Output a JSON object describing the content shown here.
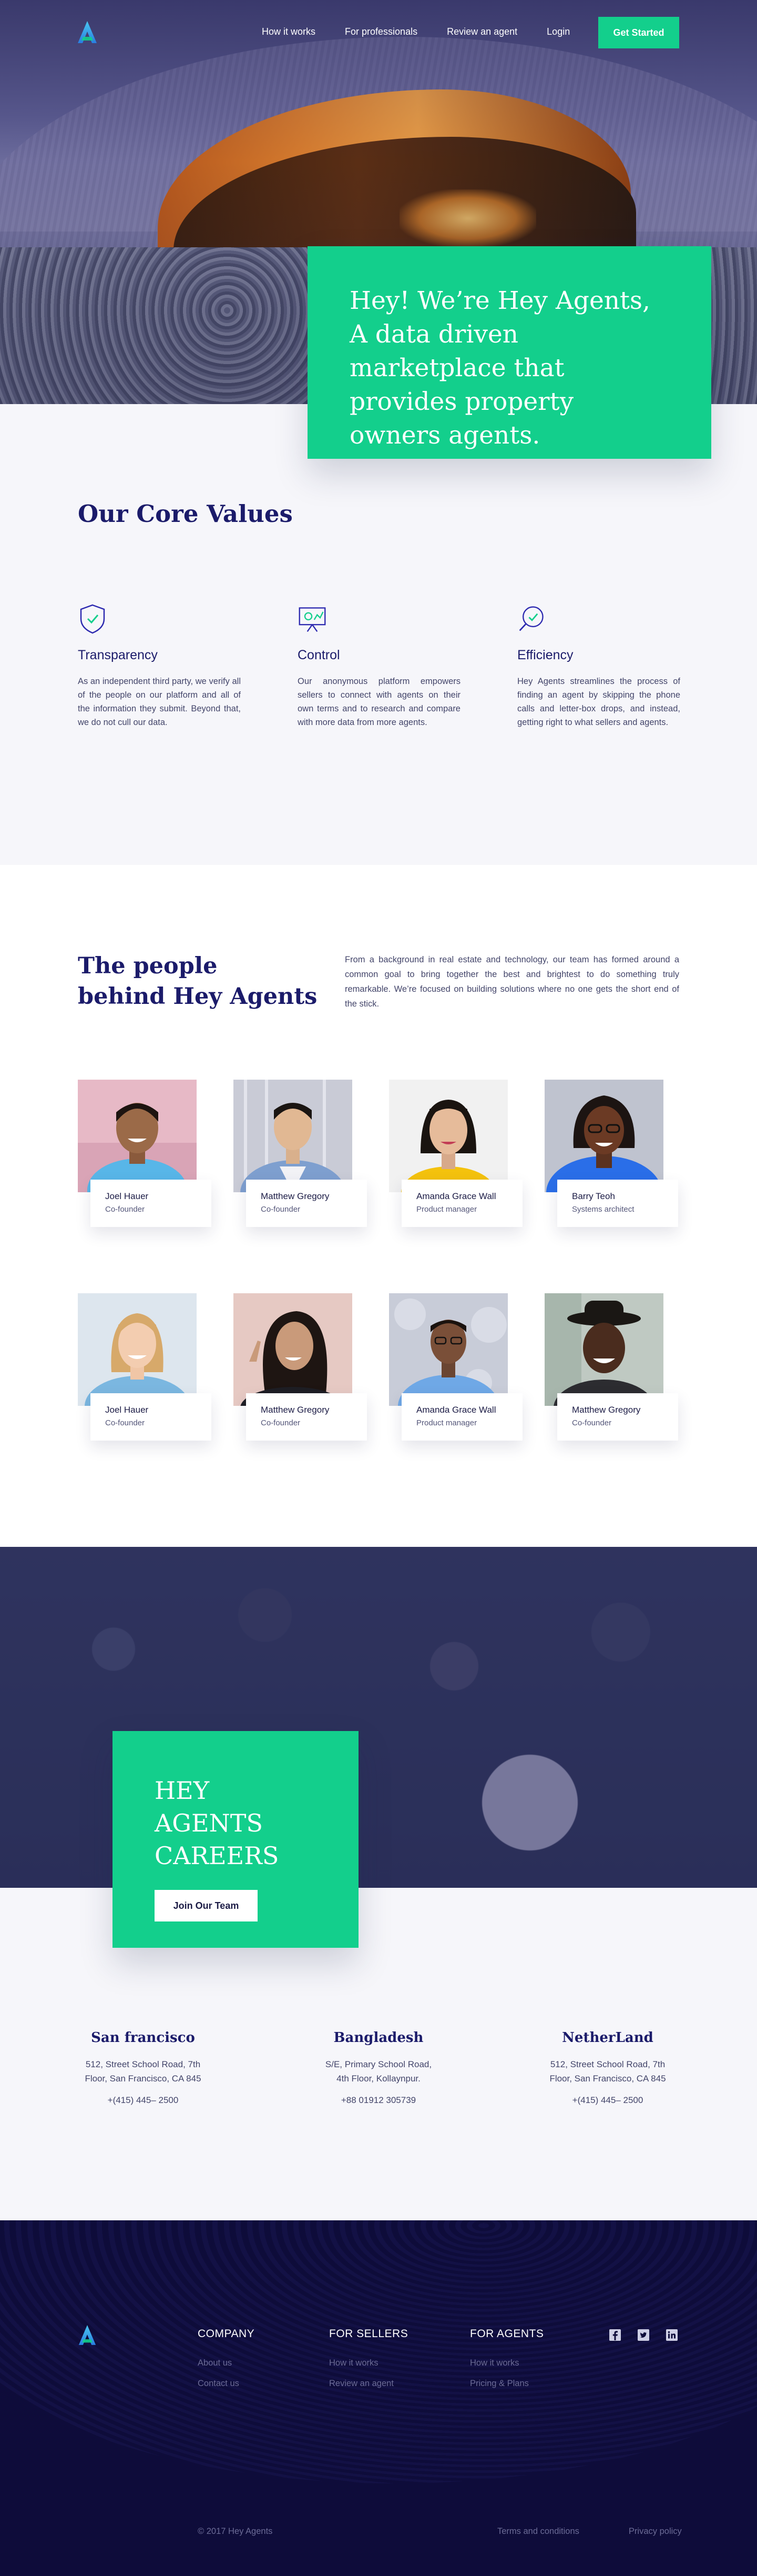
{
  "nav": {
    "links": [
      "How it works",
      "For professionals",
      "Review an agent",
      "Login"
    ],
    "cta": "Get Started"
  },
  "hero": {
    "headline": "Hey! We’re Hey Agents, A data driven marketplace that provides property owners agents."
  },
  "values": {
    "title": "Our Core Values",
    "items": [
      {
        "icon": "shield-check-icon",
        "title": "Transparency",
        "text": "As an independent third party, we verify all of the people on our platform and all of the information they submit. Beyond that, we do not cull our data."
      },
      {
        "icon": "board-chart-icon",
        "title": "Control",
        "text": "Our anonymous platform empowers sellers to connect with agents on their own terms and to research and compare with more data from more agents."
      },
      {
        "icon": "magnifier-check-icon",
        "title": "Efficiency",
        "text": "Hey Agents streamlines the process of finding an agent by skipping the phone calls and letter-box drops, and instead, getting right to what sellers and agents."
      }
    ]
  },
  "people": {
    "title_line1": "The people",
    "title_line2": "behind Hey Agents",
    "intro": "From a background in real estate and technology, our team has formed around a common goal to bring together the best and brightest to do something truly remarkable. We’re focused on building solutions where no one gets the short end of the stick.",
    "members": [
      {
        "name": "Joel Hauer",
        "role": "Co-founder"
      },
      {
        "name": "Matthew Gregory",
        "role": "Co-founder"
      },
      {
        "name": "Amanda Grace Wall",
        "role": "Product manager"
      },
      {
        "name": "Barry Teoh",
        "role": "Systems architect"
      },
      {
        "name": "Joel Hauer",
        "role": "Co-founder"
      },
      {
        "name": "Matthew Gregory",
        "role": "Co-founder"
      },
      {
        "name": "Amanda Grace Wall",
        "role": "Product manager"
      },
      {
        "name": "Matthew Gregory",
        "role": "Co-founder"
      }
    ]
  },
  "careers": {
    "title_line1": "HEY AGENTS",
    "title_line2": "CAREERS",
    "button": "Join Our Team"
  },
  "offices": [
    {
      "city": "San francisco",
      "addr_line1": "512, Street School Road, 7th",
      "addr_line2": "Floor, San Francisco, CA 845",
      "phone": "+(415) 445– 2500"
    },
    {
      "city": "Bangladesh",
      "addr_line1": "S/E, Primary School Road,",
      "addr_line2": "4th Floor, Kollaynpur.",
      "phone": "+88 01912 305739"
    },
    {
      "city": "NetherLand",
      "addr_line1": "512, Street School Road, 7th",
      "addr_line2": "Floor, San Francisco, CA 845",
      "phone": "+(415) 445– 2500"
    }
  ],
  "footer": {
    "company": {
      "title": "COMPANY",
      "links": [
        "About us",
        "Contact us"
      ]
    },
    "sellers": {
      "title": "FOR SELLERS",
      "links": [
        "How it works",
        "Review an agent"
      ]
    },
    "agents": {
      "title": "FOR AGENTS",
      "links": [
        "How it works",
        "Pricing & Plans"
      ]
    },
    "socials": [
      "facebook-icon",
      "twitter-icon",
      "linkedin-icon"
    ],
    "copyright": "© 2017 Hey Agents",
    "legal": [
      "Terms and conditions",
      "Privacy policy"
    ]
  },
  "colors": {
    "accent": "#13cf8c",
    "navy": "#1b1b6a",
    "footer_bg": "#0e0c3a"
  }
}
